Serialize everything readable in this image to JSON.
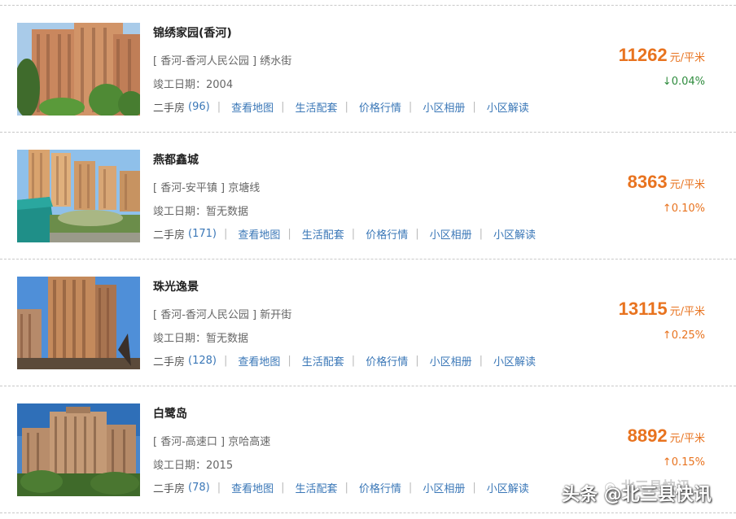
{
  "items": [
    {
      "name": "锦绣家园(香河)",
      "location": "[ 香河-香河人民公园 ] 绣水街",
      "completion": "竣工日期：2004",
      "ershou_label": "二手房",
      "ershou_count": "(96)",
      "links": [
        "查看地图",
        "生活配套",
        "价格行情",
        "小区相册",
        "小区解读"
      ],
      "price": "11262",
      "unit": "元/平米",
      "change": "↓0.04%",
      "change_dir": "down"
    },
    {
      "name": "燕都鑫城",
      "location": "[ 香河-安平镇 ] 京塘线",
      "completion": "竣工日期：暂无数据",
      "ershou_label": "二手房",
      "ershou_count": "(171)",
      "links": [
        "查看地图",
        "生活配套",
        "价格行情",
        "小区相册",
        "小区解读"
      ],
      "price": "8363",
      "unit": "元/平米",
      "change": "↑0.10%",
      "change_dir": "up"
    },
    {
      "name": "珠光逸景",
      "location": "[ 香河-香河人民公园 ] 新开街",
      "completion": "竣工日期：暂无数据",
      "ershou_label": "二手房",
      "ershou_count": "(128)",
      "links": [
        "查看地图",
        "生活配套",
        "价格行情",
        "小区相册",
        "小区解读"
      ],
      "price": "13115",
      "unit": "元/平米",
      "change": "↑0.25%",
      "change_dir": "up"
    },
    {
      "name": "白鹭岛",
      "location": "[ 香河-高速口 ] 京哈高速",
      "completion": "竣工日期：2015",
      "ershou_label": "二手房",
      "ershou_count": "(78)",
      "links": [
        "查看地图",
        "生活配套",
        "价格行情",
        "小区相册",
        "小区解读"
      ],
      "price": "8892",
      "unit": "元/平米",
      "change": "↑0.15%",
      "change_dir": "up"
    }
  ],
  "watermark": {
    "text": "头条 @北三县快讯",
    "faint_text": "北三县快讯"
  },
  "colors": {
    "price": "#e8731f",
    "link": "#3a77b7",
    "down": "#2e8b3d",
    "up": "#e8731f"
  },
  "icons": {
    "thumbnail": "building-photo",
    "watermark_logo": "wechat-icon"
  }
}
